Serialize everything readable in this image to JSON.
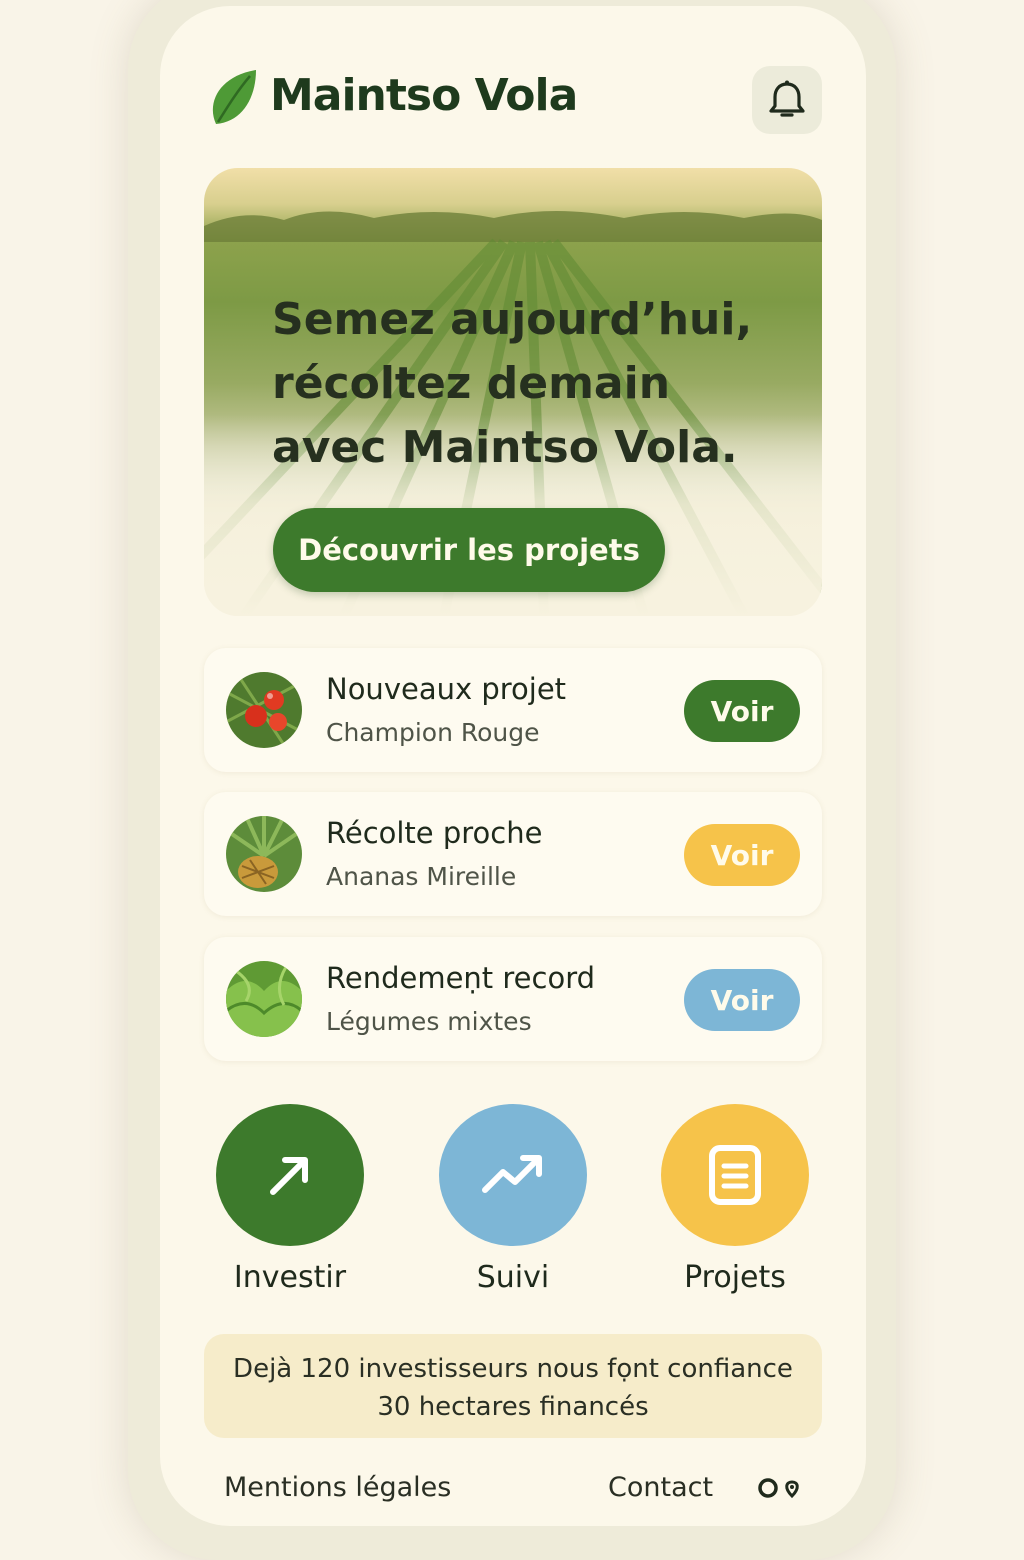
{
  "app": {
    "title": "Maintso Vola",
    "brand_color": "#3d7a2c"
  },
  "header": {
    "notification_icon": "bell-icon",
    "logo_icon": "leaf-icon"
  },
  "hero": {
    "title_lines": [
      "Semez aujourd’hui,",
      "récoltez demain",
      "avec Maintso Vola."
    ],
    "cta_label": "Découvrir les projets"
  },
  "cards": [
    {
      "title": "Nouveaux projet",
      "subtitle": "Champion Rouge",
      "button": "Voir",
      "button_color": "#3d7a2c",
      "thumb": "tomato-plant"
    },
    {
      "title": "Récolte proche",
      "subtitle": "Ananas Mireille",
      "button": "Voir",
      "button_color": "#f6c34a",
      "thumb": "pineapple"
    },
    {
      "title": "Rendemeṇt record",
      "subtitle": "Légumes mixtes",
      "button": "Voir",
      "button_color": "#7db6d6",
      "thumb": "lettuce"
    }
  ],
  "actions": [
    {
      "label": "Investir",
      "icon": "arrow-up-right-icon",
      "color": "#3d7a2c"
    },
    {
      "label": "Suivi",
      "icon": "trend-up-icon",
      "color": "#7db6d6"
    },
    {
      "label": "Projets",
      "icon": "document-icon",
      "color": "#f6c34a"
    }
  ],
  "stats": {
    "line1": "Dejà 120 investisseurs nous fọnt confiance",
    "line2": "30 hectares financés"
  },
  "footer": {
    "legal": "Mentions légales",
    "contact": "Contact",
    "icons": "social-icons"
  }
}
